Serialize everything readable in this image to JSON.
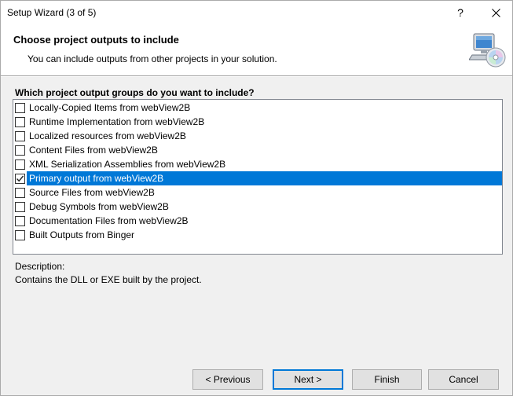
{
  "window": {
    "title": "Setup Wizard (3 of 5)",
    "help_glyph": "?",
    "close_icon": "close-icon"
  },
  "header": {
    "title": "Choose project outputs to include",
    "subtitle": "You can include outputs from other projects in your solution.",
    "icon": "computer-cd-icon"
  },
  "question": "Which project output groups do you want to include?",
  "outputs": [
    {
      "label": "Locally-Copied Items from webView2B",
      "checked": false,
      "selected": false
    },
    {
      "label": "Runtime Implementation from webView2B",
      "checked": false,
      "selected": false
    },
    {
      "label": "Localized resources from webView2B",
      "checked": false,
      "selected": false
    },
    {
      "label": "Content Files from webView2B",
      "checked": false,
      "selected": false
    },
    {
      "label": "XML Serialization Assemblies from webView2B",
      "checked": false,
      "selected": false
    },
    {
      "label": "Primary output from webView2B",
      "checked": true,
      "selected": true
    },
    {
      "label": "Source Files from webView2B",
      "checked": false,
      "selected": false
    },
    {
      "label": "Debug Symbols from webView2B",
      "checked": false,
      "selected": false
    },
    {
      "label": "Documentation Files from webView2B",
      "checked": false,
      "selected": false
    },
    {
      "label": "Built Outputs from Binger",
      "checked": false,
      "selected": false
    }
  ],
  "description": {
    "label": "Description:",
    "text": "Contains the DLL or EXE built by the project."
  },
  "buttons": {
    "previous": "< Previous",
    "next": "Next >",
    "finish": "Finish",
    "cancel": "Cancel"
  },
  "colors": {
    "selection": "#0078d7",
    "dialog_bg": "#f0f0f0",
    "header_bg": "#ffffff"
  }
}
